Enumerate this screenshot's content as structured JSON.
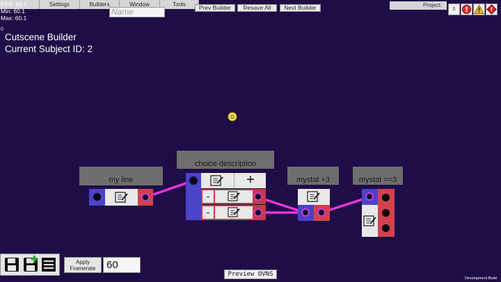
{
  "menu": {
    "items": [
      "Settings",
      "Builders",
      "Window",
      "Tools"
    ]
  },
  "stats": {
    "fps": "FPS: 60.1",
    "min": "Min: 60.1",
    "max": "Max: 60.1",
    "zero": "0"
  },
  "toolbar": {
    "prev_builder": "Prev Builder",
    "resave_all": "Resave All",
    "next_builder": "Next Builder"
  },
  "name_field": {
    "placeholder": "Name"
  },
  "project": {
    "label": "Project: 'c'"
  },
  "status_icons": {
    "count": "0",
    "error_count": "0",
    "warning_count": "0"
  },
  "header": {
    "title": "Cutscene Builder",
    "subject": "Current Subject ID: 2"
  },
  "nodes": {
    "my_line": {
      "title": "my line"
    },
    "choice": {
      "title": "choice description",
      "add": "+",
      "minus": "-"
    },
    "stat_add": {
      "title": "mystat +3"
    },
    "stat_check": {
      "title": "mystat ==3"
    }
  },
  "bottom": {
    "apply_framerate": "Apply Framerate",
    "framerate_value": "60",
    "preview": "Preview OVNS",
    "dev_build": "Development Build"
  },
  "colors": {
    "background": "#1f0d47",
    "connection": "#e636d9",
    "input_port": "#4b43c8",
    "output_port": "#d2404e"
  }
}
